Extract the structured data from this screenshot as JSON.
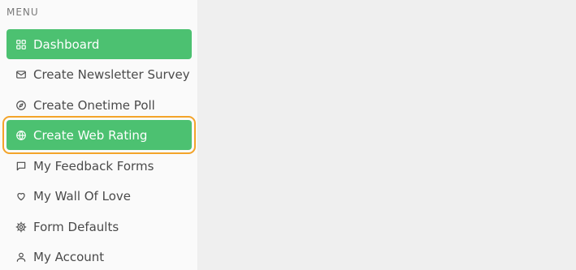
{
  "sidebar": {
    "menu_label": "MENU",
    "items": [
      {
        "label": "Dashboard",
        "icon": "grid-icon",
        "active": true
      },
      {
        "label": "Create Newsletter Survey",
        "icon": "mail-icon",
        "active": false
      },
      {
        "label": "Create Onetime Poll",
        "icon": "compass-icon",
        "active": false
      },
      {
        "label": "Create Web Rating",
        "icon": "globe-icon",
        "active": true,
        "highlighted": true
      },
      {
        "label": "My Feedback Forms",
        "icon": "message-square-icon",
        "active": false
      },
      {
        "label": "My Wall Of Love",
        "icon": "heart-icon",
        "active": false
      },
      {
        "label": "Form Defaults",
        "icon": "gear-icon",
        "active": false
      },
      {
        "label": "My Account",
        "icon": "user-icon",
        "active": false
      }
    ]
  },
  "colors": {
    "active_bg": "#4cc171",
    "highlight_ring": "#f3a42a",
    "sidebar_bg": "#fafafa",
    "main_bg": "#efefef",
    "text": "#4a4a4a"
  }
}
